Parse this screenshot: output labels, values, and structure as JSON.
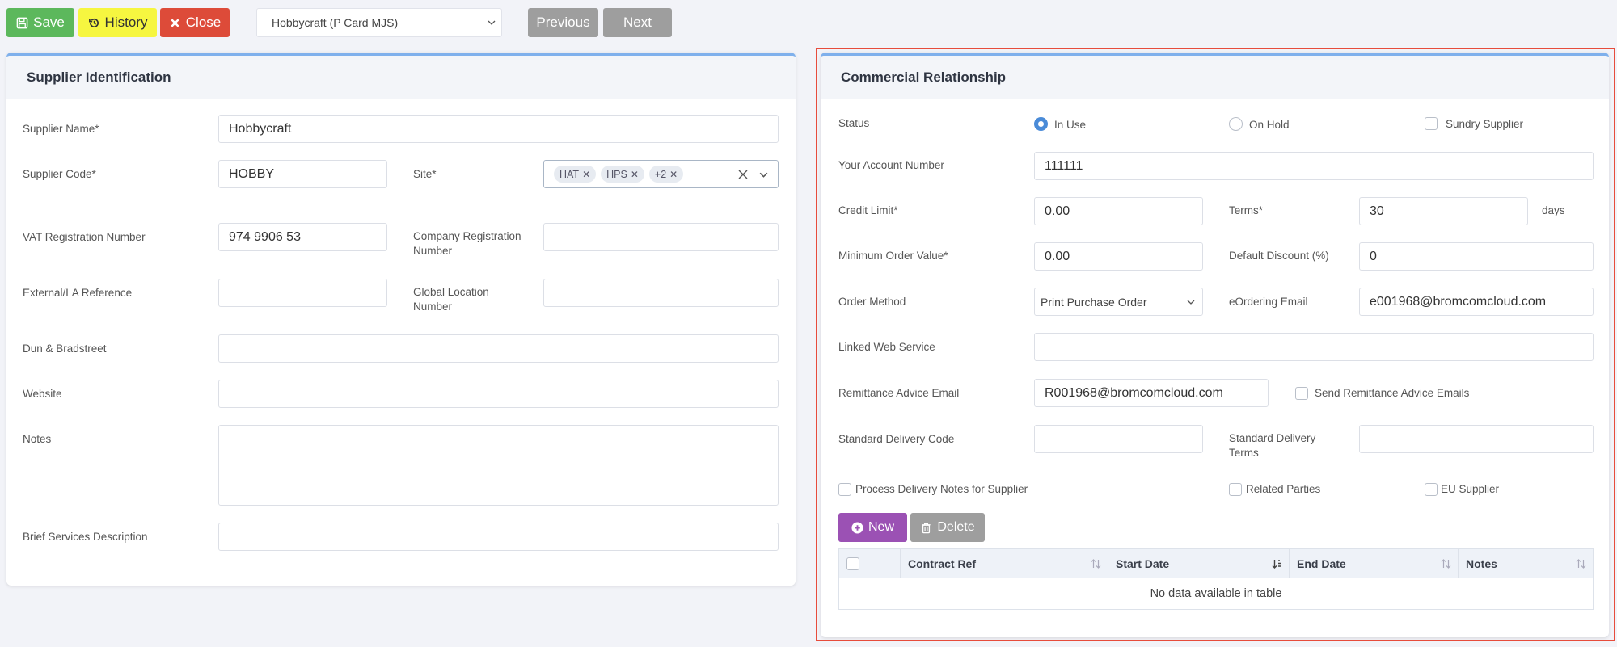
{
  "toolbar": {
    "save_label": "Save",
    "history_label": "History",
    "close_label": "Close",
    "record_select": "Hobbycraft (P Card MJS)",
    "previous_label": "Previous",
    "next_label": "Next"
  },
  "supplier_identification": {
    "title": "Supplier Identification",
    "supplier_name_label": "Supplier Name*",
    "supplier_name_value": "Hobbycraft",
    "supplier_code_label": "Supplier Code*",
    "supplier_code_value": "HOBBY",
    "site_label": "Site*",
    "site_tags": [
      "HAT",
      "HPS",
      "+2"
    ],
    "vat_label": "VAT Registration Number",
    "vat_value": "974 9906 53",
    "company_reg_label": "Company Registration Number",
    "company_reg_value": "",
    "external_ref_label": "External/LA Reference",
    "external_ref_value": "",
    "gln_label": "Global Location Number",
    "gln_value": "",
    "duns_label": "Dun & Bradstreet",
    "duns_value": "",
    "website_label": "Website",
    "website_value": "",
    "notes_label": "Notes",
    "notes_value": "",
    "brief_label": "Brief Services Description",
    "brief_value": ""
  },
  "commercial_relationship": {
    "title": "Commercial Relationship",
    "status_label": "Status",
    "status_in_use": "In Use",
    "status_on_hold": "On Hold",
    "status_selected": "In Use",
    "sundry_label": "Sundry Supplier",
    "account_label": "Your Account Number",
    "account_value": "111111",
    "credit_limit_label": "Credit Limit*",
    "credit_limit_value": "0.00",
    "terms_label": "Terms*",
    "terms_value": "30",
    "terms_unit": "days",
    "min_order_label": "Minimum Order Value*",
    "min_order_value": "0.00",
    "discount_label": "Default Discount (%)",
    "discount_value": "0",
    "order_method_label": "Order Method",
    "order_method_value": "Print Purchase Order",
    "eordering_label": "eOrdering Email",
    "eordering_value": "e001968@bromcomcloud.com",
    "web_service_label": "Linked Web Service",
    "web_service_value": "",
    "remittance_label": "Remittance Advice Email",
    "remittance_value": "R001968@bromcomcloud.com",
    "send_remittance_label": "Send Remittance Advice Emails",
    "delivery_code_label": "Standard Delivery Code",
    "delivery_code_value": "",
    "delivery_terms_label": "Standard Delivery Terms",
    "delivery_terms_value": "",
    "process_notes_label": "Process Delivery Notes for Supplier",
    "related_parties_label": "Related Parties",
    "eu_supplier_label": "EU Supplier",
    "new_label": "New",
    "delete_label": "Delete",
    "table": {
      "columns": [
        "Contract Ref",
        "Start Date",
        "End Date",
        "Notes"
      ],
      "empty_message": "No data available in table"
    }
  },
  "colors": {
    "save": "#5cb85c",
    "history": "#f6f640",
    "close": "#dd4b39",
    "nav": "#9e9e9e",
    "new": "#9b51b4",
    "accent": "#4a8bd8",
    "highlight": "#e74c3c"
  }
}
